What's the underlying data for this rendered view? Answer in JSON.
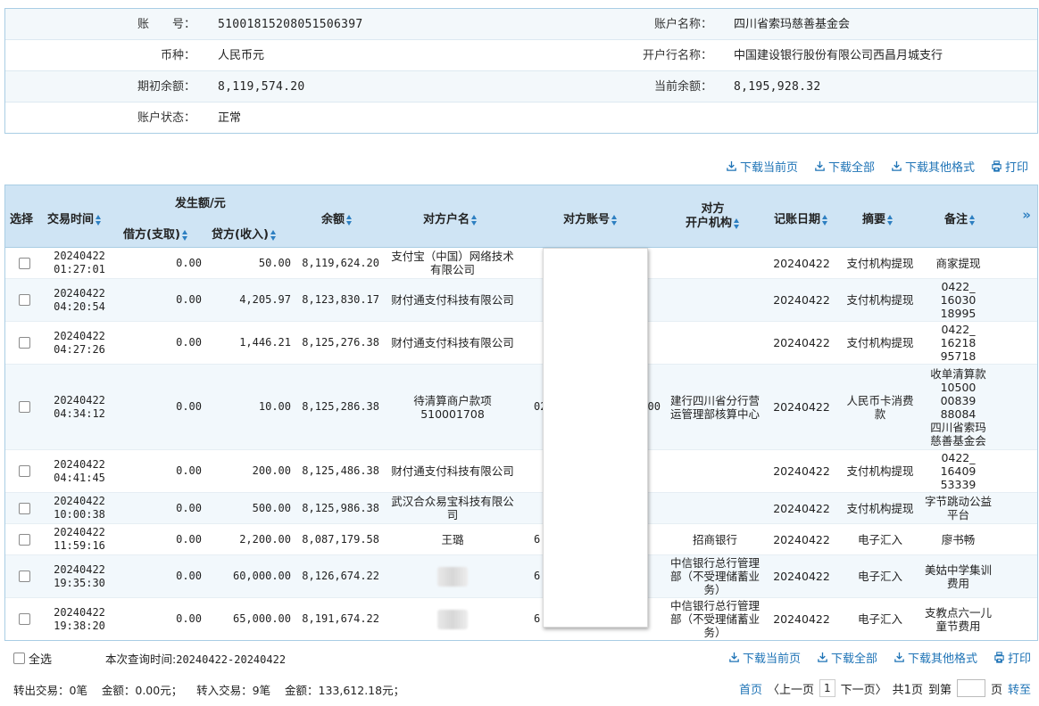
{
  "account": {
    "number_label": "账　　号：",
    "number": "51001815208051506397",
    "name_label": "账户名称：",
    "name": "四川省索玛慈善基金会",
    "currency_label": "币种：",
    "currency": "人民币元",
    "bank_label": "开户行名称：",
    "bank": "中国建设银行股份有限公司西昌月城支行",
    "opening_label": "期初余额：",
    "opening": "8,119,574.20",
    "current_label": "当前余额：",
    "current": "8,195,928.32",
    "status_label": "账户状态：",
    "status": "正常"
  },
  "toolbar": {
    "download_page": "下载当前页",
    "download_all": "下载全部",
    "download_other": "下载其他格式",
    "print": "打印"
  },
  "table": {
    "headers": {
      "select": "选择",
      "time": "交易时间",
      "amount_group": "发生额/元",
      "debit": "借方(支取)",
      "credit": "贷方(收入)",
      "balance": "余额",
      "party_name": "对方户名",
      "party_account": "对方账号",
      "party_bank_1": "对方",
      "party_bank_2": "开户机构",
      "book_date": "记账日期",
      "summary": "摘要",
      "remark": "备注",
      "more": "»"
    },
    "rows": [
      {
        "date": "20240422",
        "time": "01:27:01",
        "debit": "0.00",
        "credit": "50.00",
        "balance": "8,119,624.20",
        "party": "支付宝（中国）网络技术有限公司",
        "acct": "",
        "bank": "",
        "book": "20240422",
        "summary": "支付机构提现",
        "remark": "商家提现"
      },
      {
        "date": "20240422",
        "time": "04:20:54",
        "debit": "0.00",
        "credit": "4,205.97",
        "balance": "8,123,830.17",
        "party": "财付通支付科技有限公司",
        "acct": "",
        "bank": "",
        "book": "20240422",
        "summary": "支付机构提现",
        "remark": "0422_\n16030\n18995"
      },
      {
        "date": "20240422",
        "time": "04:27:26",
        "debit": "0.00",
        "credit": "1,446.21",
        "balance": "8,125,276.38",
        "party": "财付通支付科技有限公司",
        "acct": "",
        "bank": "",
        "book": "20240422",
        "summary": "支付机构提现",
        "remark": "0422_\n16218\n95718"
      },
      {
        "date": "20240422",
        "time": "04:34:12",
        "debit": "0.00",
        "credit": "10.00",
        "balance": "8,125,286.38",
        "party": "待清算商户款项510001708",
        "acct": "02",
        "acct_tail": "00",
        "bank": "建行四川省分行营运管理部核算中心",
        "book": "20240422",
        "summary": "人民币卡消费款",
        "remark": "收单清算款\n10500\n00839\n88084\n四川省索玛\n慈善基金会"
      },
      {
        "date": "20240422",
        "time": "04:41:45",
        "debit": "0.00",
        "credit": "200.00",
        "balance": "8,125,486.38",
        "party": "财付通支付科技有限公司",
        "acct": "",
        "bank": "",
        "book": "20240422",
        "summary": "支付机构提现",
        "remark": "0422_\n16409\n53339"
      },
      {
        "date": "20240422",
        "time": "10:00:38",
        "debit": "0.00",
        "credit": "500.00",
        "balance": "8,125,986.38",
        "party": "武汉合众易宝科技有限公司",
        "acct": "",
        "bank": "",
        "book": "20240422",
        "summary": "支付机构提现",
        "remark": "字节跳动公益平台"
      },
      {
        "date": "20240422",
        "time": "11:59:16",
        "debit": "0.00",
        "credit": "2,200.00",
        "balance": "8,087,179.58",
        "party": "王璐",
        "acct": "6",
        "bank": "招商银行",
        "book": "20240422",
        "summary": "电子汇入",
        "remark": "廖书畅"
      },
      {
        "date": "20240422",
        "time": "19:35:30",
        "debit": "0.00",
        "credit": "60,000.00",
        "balance": "8,126,674.22",
        "party": "",
        "acct": "6",
        "bank": "中信银行总行管理部（不受理储蓄业务）",
        "book": "20240422",
        "summary": "电子汇入",
        "remark": "美姑中学集训费用"
      },
      {
        "date": "20240422",
        "time": "19:38:20",
        "debit": "0.00",
        "credit": "65,000.00",
        "balance": "8,191,674.22",
        "party": "",
        "acct": "6",
        "bank": "中信银行总行管理部（不受理储蓄业务）",
        "book": "20240422",
        "summary": "电子汇入",
        "remark": "支教点六一儿童节费用"
      }
    ]
  },
  "footer": {
    "select_all": "全选",
    "query_time_label": "本次查询时间:",
    "query_time": "20240422-20240422",
    "out_count": "转出交易：0笔",
    "out_amount": "金额：0.00元；",
    "in_count": "转入交易：9笔",
    "in_amount": "金额：133,612.18元；",
    "first": "首页",
    "prev": "〈上一页",
    "page": "1",
    "next": "下一页〉",
    "total": "共1页",
    "goto": "到第",
    "page_unit": "页",
    "go": "转至"
  },
  "colors": {
    "link": "#1e73b6",
    "header_bg": "#cfe4f4",
    "border": "#a9cde4",
    "row_alt": "#f2f8fc"
  }
}
